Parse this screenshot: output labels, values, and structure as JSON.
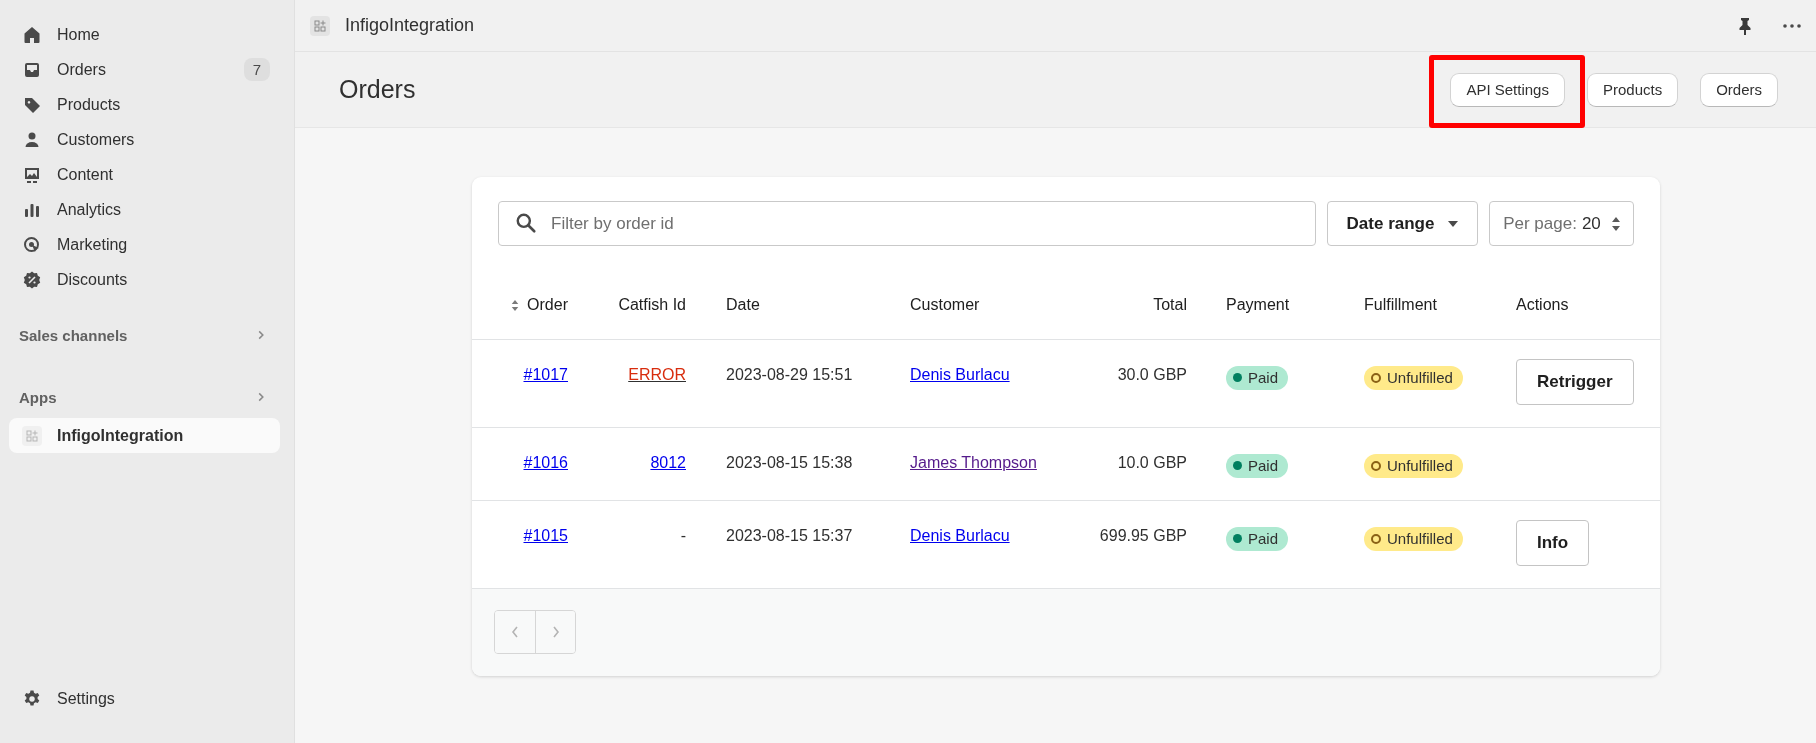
{
  "sidebar": {
    "items": [
      {
        "label": "Home",
        "selected": false
      },
      {
        "label": "Orders",
        "badge": "7",
        "selected": false
      },
      {
        "label": "Products",
        "selected": false
      },
      {
        "label": "Customers",
        "selected": false
      },
      {
        "label": "Content",
        "selected": false
      },
      {
        "label": "Analytics",
        "selected": false
      },
      {
        "label": "Marketing",
        "selected": false
      },
      {
        "label": "Discounts",
        "selected": false
      }
    ],
    "sections": [
      {
        "title": "Sales channels"
      },
      {
        "title": "Apps",
        "items": [
          {
            "label": "InfigoIntegration",
            "selected": true
          }
        ]
      }
    ],
    "footer_item": {
      "label": "Settings"
    }
  },
  "top_bar": {
    "app_title": "InfigoIntegration"
  },
  "page": {
    "title": "Orders",
    "buttons": [
      {
        "label": "API Settings",
        "highlighted": true
      },
      {
        "label": "Products",
        "highlighted": false
      },
      {
        "label": "Orders",
        "highlighted": false
      }
    ]
  },
  "filters": {
    "search": {
      "placeholder": "Filter by order id"
    },
    "date_range": {
      "label": "Date range"
    },
    "per_page": {
      "label": "Per page:",
      "value": "20"
    }
  },
  "table": {
    "columns": [
      {
        "label": "Order",
        "sortable": true
      },
      {
        "label": "Catfish Id",
        "sortable": false
      },
      {
        "label": "Date",
        "sortable": false
      },
      {
        "label": "Customer",
        "sortable": false
      },
      {
        "label": "Total",
        "sortable": false
      },
      {
        "label": "Payment",
        "sortable": false
      },
      {
        "label": "Fulfillment",
        "sortable": false
      },
      {
        "label": "Actions",
        "sortable": false
      }
    ],
    "rows": [
      {
        "order": "#1017",
        "catfish_id": {
          "text": "ERROR",
          "kind": "error"
        },
        "date": "2023-08-29 15:51",
        "customer": {
          "name": "Denis Burlacu",
          "visited": false
        },
        "total": "30.0 GBP",
        "payment": {
          "label": "Paid",
          "kind": "paid"
        },
        "fulfillment": {
          "label": "Unfulfilled",
          "kind": "unfulfilled"
        },
        "action": "Retrigger"
      },
      {
        "order": "#1016",
        "catfish_id": {
          "text": "8012",
          "kind": "link"
        },
        "date": "2023-08-15 15:38",
        "customer": {
          "name": "James Thompson",
          "visited": true
        },
        "total": "10.0 GBP",
        "payment": {
          "label": "Paid",
          "kind": "paid"
        },
        "fulfillment": {
          "label": "Unfulfilled",
          "kind": "unfulfilled"
        }
      },
      {
        "order": "#1015",
        "catfish_id": {
          "text": "-",
          "kind": "plain"
        },
        "date": "2023-08-15 15:37",
        "customer": {
          "name": "Denis Burlacu",
          "visited": false
        },
        "total": "699.95 GBP",
        "payment": {
          "label": "Paid",
          "kind": "paid"
        },
        "fulfillment": {
          "label": "Unfulfilled",
          "kind": "unfulfilled"
        },
        "action": "Info"
      }
    ]
  },
  "pagination": {
    "buttons": [
      {
        "kind": "previous",
        "disabled": true
      },
      {
        "kind": "next",
        "disabled": true
      }
    ]
  }
}
